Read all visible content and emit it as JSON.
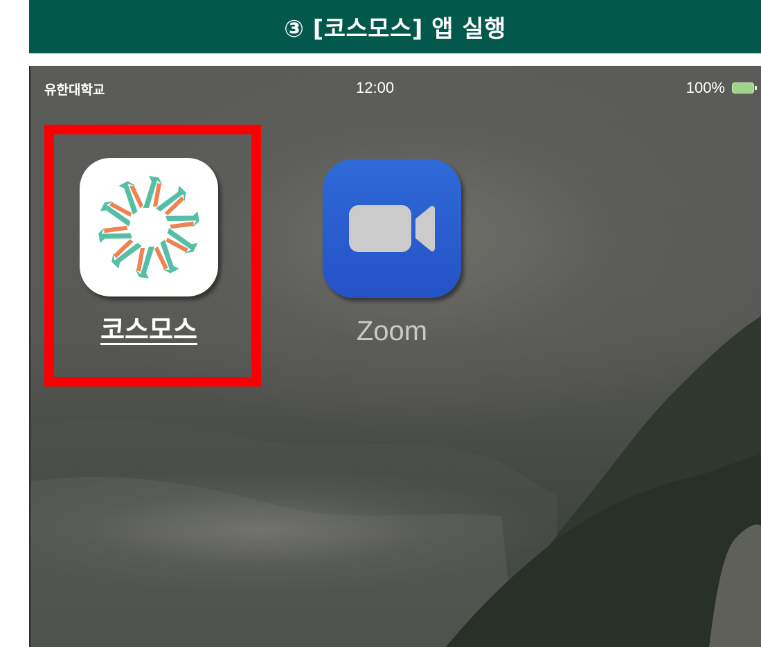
{
  "header": {
    "title": "③ [코스모스] 앱 실행"
  },
  "status_bar": {
    "carrier": "유한대학교",
    "time": "12:00",
    "battery_percent": "100%"
  },
  "apps": [
    {
      "label": "코스모스",
      "icon": "cosmos-starburst-icon",
      "highlighted": true
    },
    {
      "label": "Zoom",
      "icon": "video-camera-icon",
      "highlighted": false
    }
  ],
  "colors": {
    "header_bg": "#02584a",
    "highlight": "#fa0000",
    "cosmos_teal": "#55bfa5",
    "cosmos_orange": "#ee8251",
    "zoom_blue": "#2e6ad6"
  }
}
